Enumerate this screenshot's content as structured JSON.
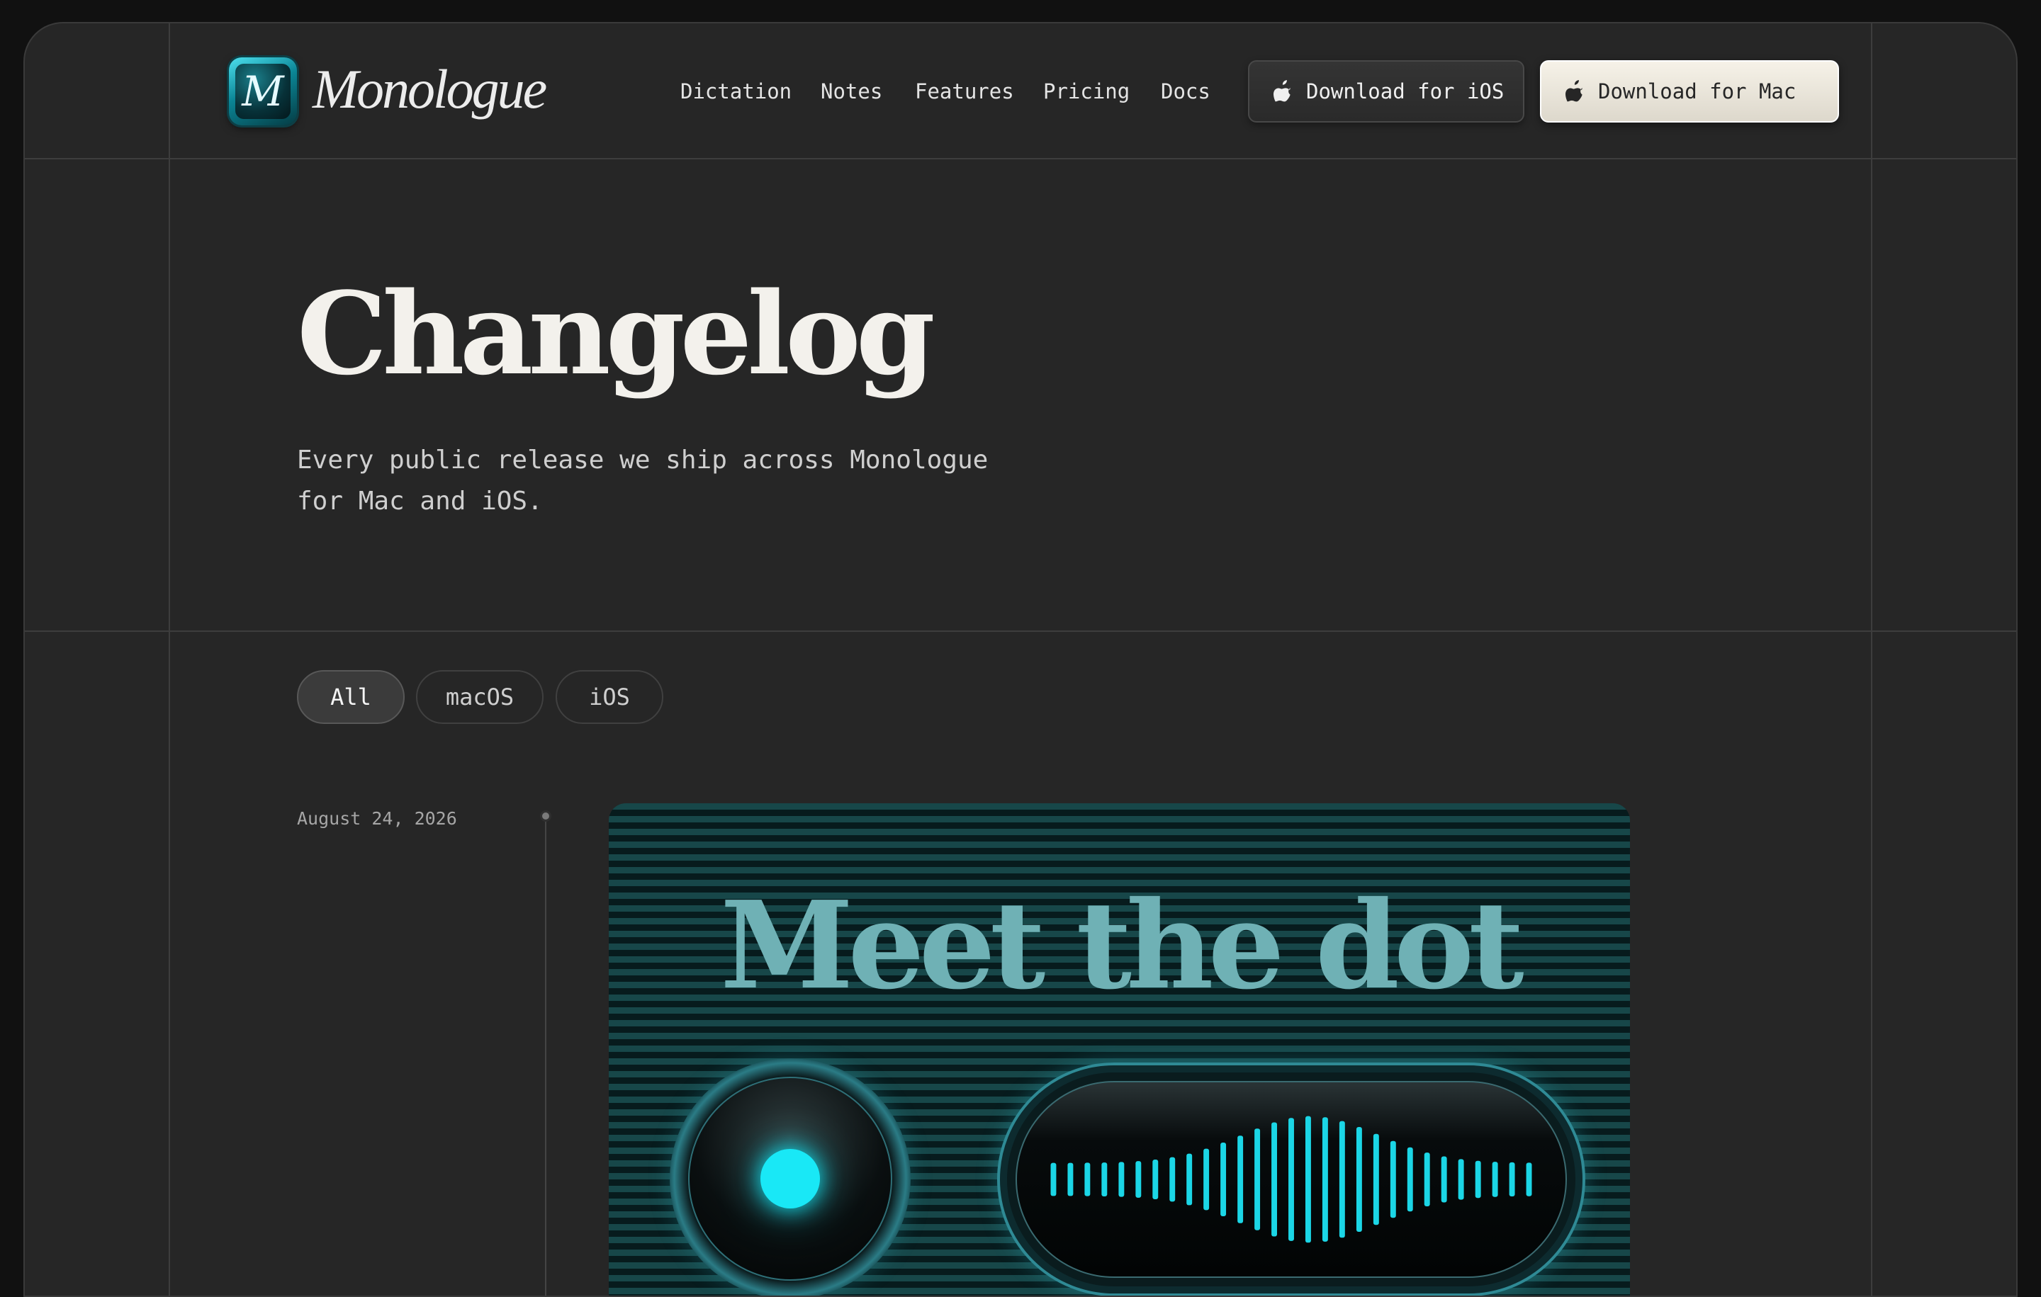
{
  "brand": {
    "logo_letter": "M",
    "name": "Monologue",
    "accent_color": "#19e8f6"
  },
  "nav": {
    "links": [
      "Dictation",
      "Notes",
      "Features",
      "Pricing",
      "Docs"
    ],
    "download_ios": "Download for iOS",
    "download_mac": "Download for Mac",
    "button_icon": "apple-icon"
  },
  "hero": {
    "title": "Changelog",
    "subtitle": "Every public release we ship across Monologue for Mac and iOS."
  },
  "filters": {
    "items": [
      "All",
      "macOS",
      "iOS"
    ],
    "selected": "All"
  },
  "entries": [
    {
      "date": "August 24, 2026",
      "image_title": "Meet the dot"
    }
  ]
}
